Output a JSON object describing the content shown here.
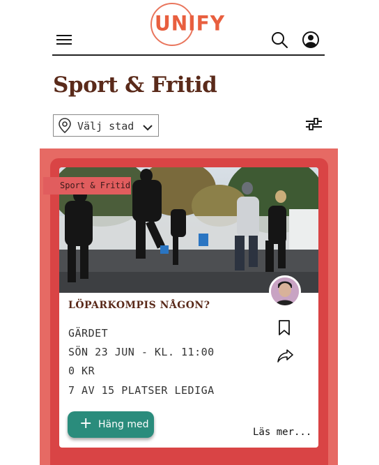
{
  "header": {
    "logo_text": "UNIFY",
    "menu_icon": "hamburger-menu-icon",
    "search_icon": "search-icon",
    "profile_icon": "user-profile-icon"
  },
  "page": {
    "title": "Sport & Fritid"
  },
  "filters": {
    "city_select": {
      "label": "Välj stad",
      "icon": "location-pin-icon",
      "chevron": "chevron-down-icon"
    },
    "filter_icon": "sliders-icon"
  },
  "event_card": {
    "category_tag": "Sport & Fritid",
    "image": "runners-outdoor-photo",
    "title": "LÖPARKOMPIS NÅGON?",
    "location": "GÄRDET",
    "datetime": "SÖN 23 JUN - KL. 11:00",
    "price": "0 KR",
    "spots": "7 AV 15 PLATSER LEDIGA",
    "join_button": "Häng med",
    "read_more": "Läs mer...",
    "bookmark_icon": "bookmark-icon",
    "share_icon": "share-icon",
    "avatar_icon": "organizer-avatar"
  },
  "colors": {
    "brand": "#e85f3f",
    "title_brown": "#5a2a1a",
    "card_outer": "#e66a64",
    "card_inner": "#d94445",
    "join_button": "#2a8c7c"
  }
}
